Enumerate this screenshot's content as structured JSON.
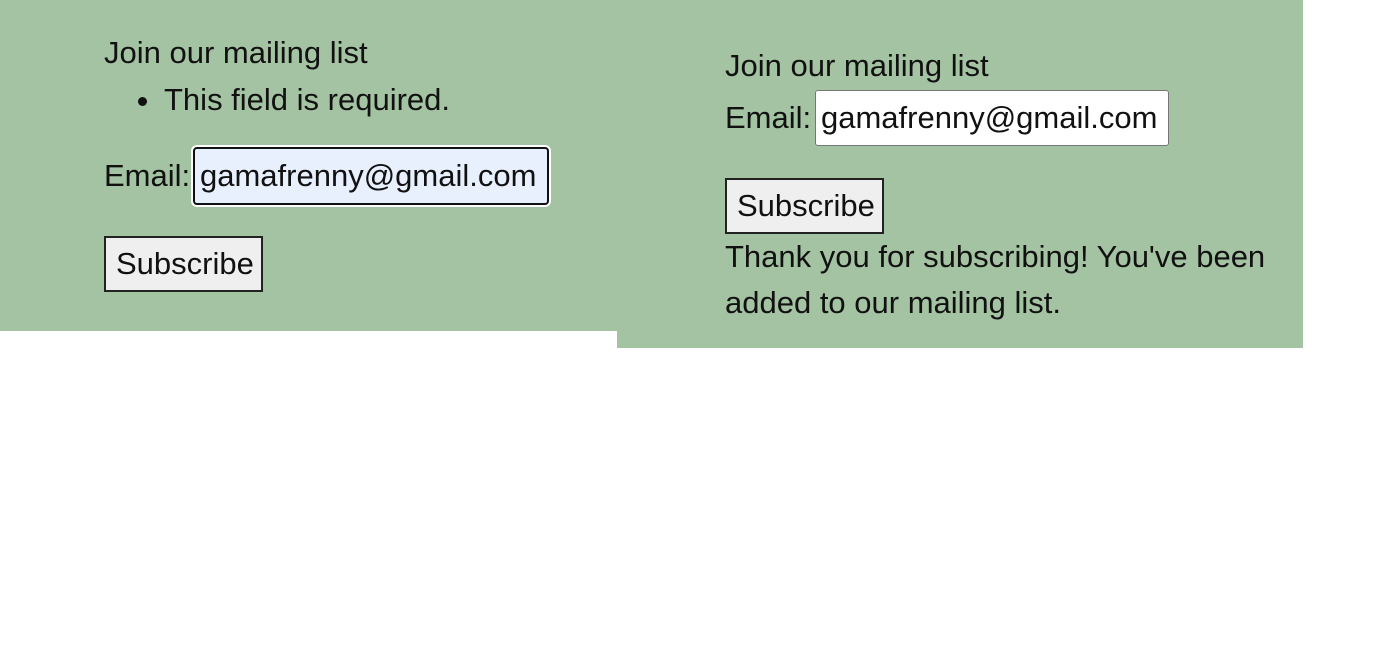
{
  "left_form": {
    "title": "Join our mailing list",
    "errors": [
      "This field is required."
    ],
    "email_label": "Email:",
    "email_value": "gamafrenny@gmail.com",
    "subscribe_label": "Subscribe"
  },
  "right_form": {
    "title": "Join our mailing list",
    "email_label": "Email:",
    "email_value": "gamafrenny@gmail.com",
    "subscribe_label": "Subscribe",
    "success_message": "Thank you for subscribing! You've been added to our mailing list."
  },
  "colors": {
    "panel_background": "#a4c3a2",
    "autofill_input_background": "#e8f0fe",
    "button_background": "#efefef",
    "page_background": "#ffffff"
  }
}
